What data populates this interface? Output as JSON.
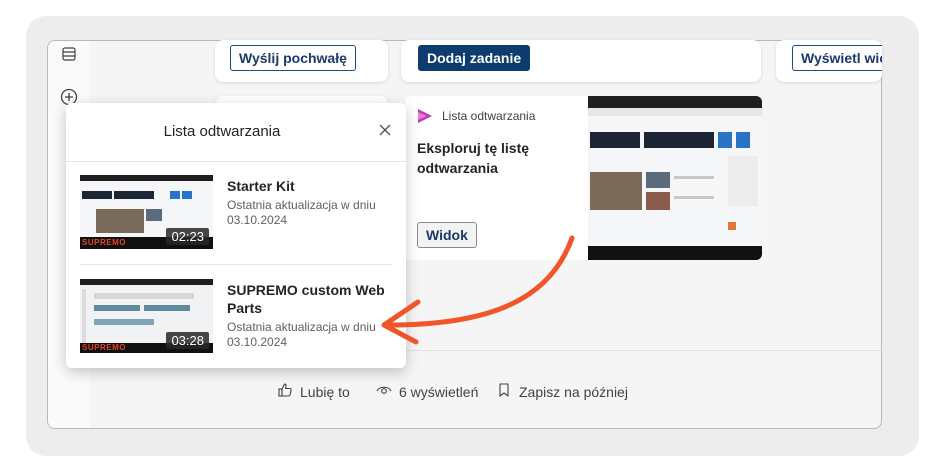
{
  "buttons": {
    "send_praise": "Wyślij pochwałę",
    "add_task": "Dodaj zadanie",
    "show_more": "Wyświetl więc"
  },
  "playlist_popup": {
    "title": "Lista odtwarzania",
    "items": [
      {
        "title": "Starter Kit",
        "meta_line1": "Ostatnia aktualizacja w dniu",
        "meta_line2": "03.10.2024",
        "duration": "02:23"
      },
      {
        "title": "SUPREMO custom Web Parts",
        "meta_line1": "Ostatnia aktualizacja w dniu",
        "meta_line2": "03.10.2024",
        "duration": "03:28"
      }
    ],
    "brand": "SUPREMO"
  },
  "promo_card": {
    "label": "Lista odtwarzania",
    "heading_line1": "Eksploruj tę listę",
    "heading_line2": "odtwarzania",
    "view_button": "Widok"
  },
  "footer": {
    "like": "Lubię to",
    "views": "6 wyświetleń",
    "save": "Zapisz na później"
  },
  "colors": {
    "accent_dark": "#0f3c6e",
    "arrow": "#f0562a",
    "stream_icon": "#c239b3"
  }
}
